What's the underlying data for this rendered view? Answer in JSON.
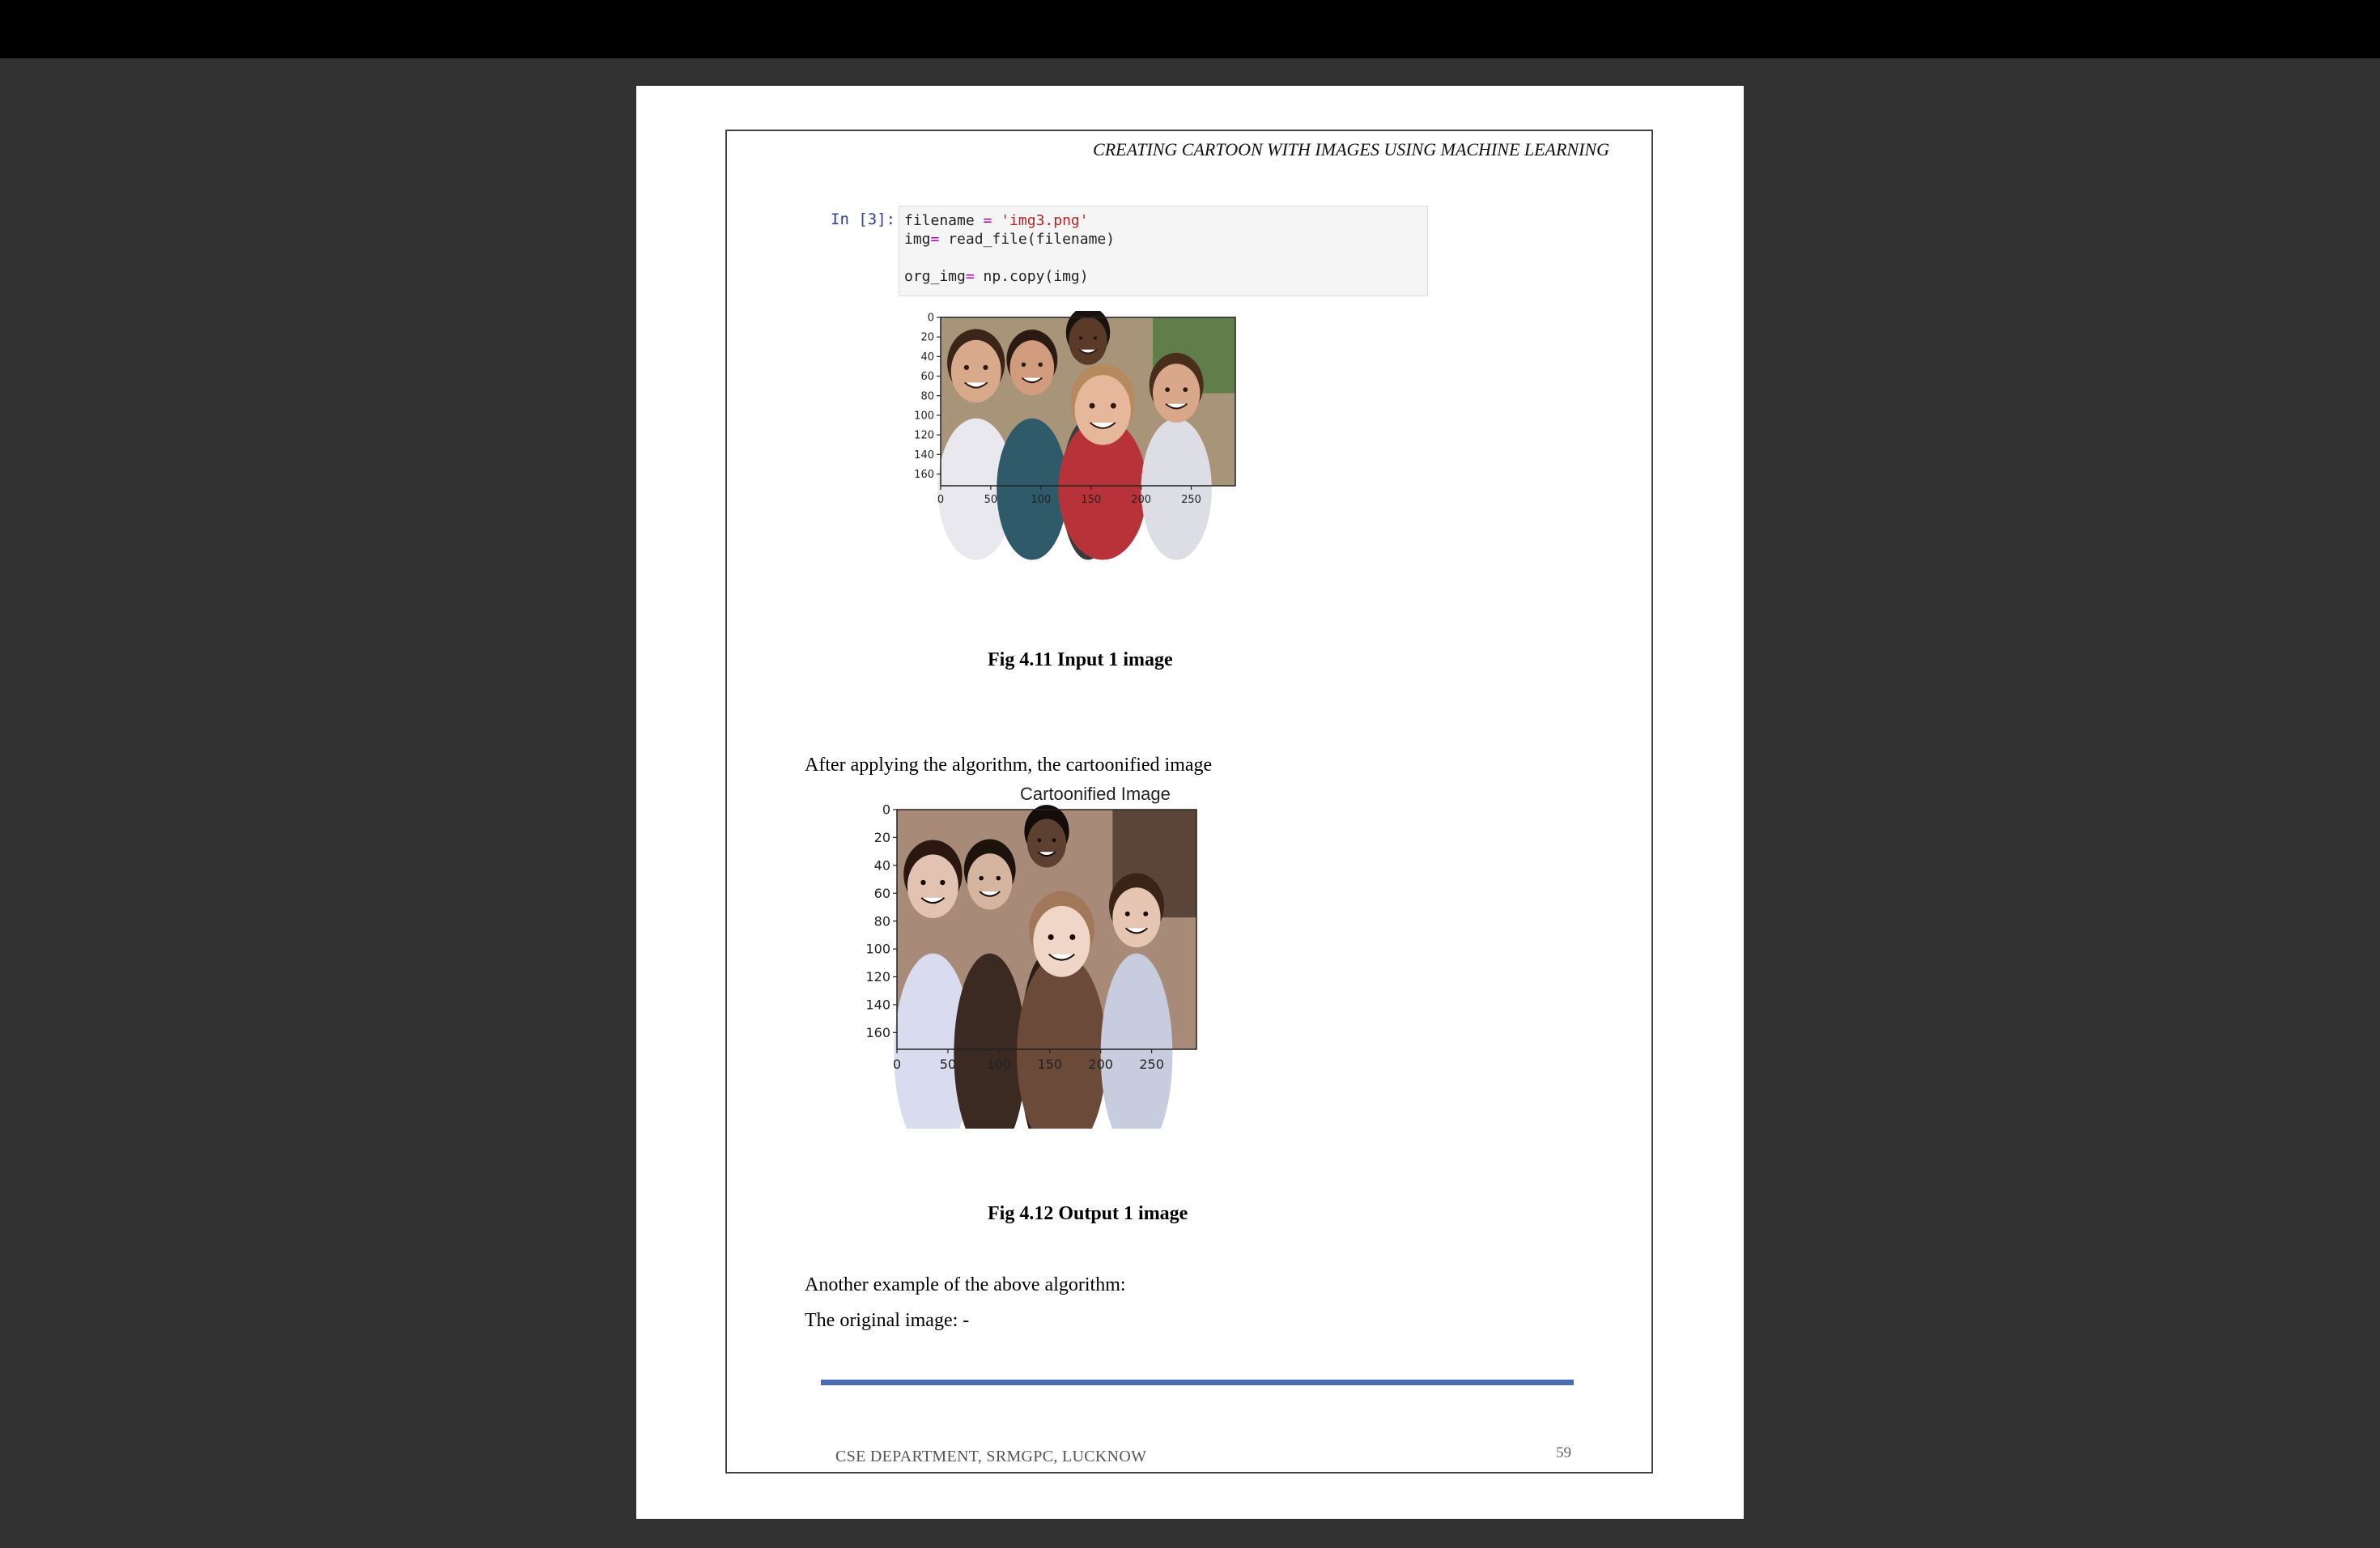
{
  "document": {
    "running_header": "CREATING CARTOON WITH IMAGES USING MACHINE LEARNING",
    "code_cell": {
      "prompt": "In [3]:",
      "lines": [
        {
          "var": "filename",
          "op": " = ",
          "rest": "'img3.png'",
          "kind": "str"
        },
        {
          "var": "img",
          "op": "= ",
          "rest": "read_file(filename)",
          "kind": "plain"
        },
        {
          "var": "",
          "op": "",
          "rest": "",
          "kind": "blank"
        },
        {
          "var": "org_img",
          "op": "= ",
          "rest": "np.copy(img)",
          "kind": "plain"
        }
      ]
    },
    "figure1": {
      "y_ticks": [
        "0",
        "20",
        "40",
        "60",
        "80",
        "100",
        "120",
        "140",
        "160"
      ],
      "x_ticks": [
        "0",
        "50",
        "100",
        "150",
        "200",
        "250"
      ],
      "caption": "Fig 4.11 Input 1 image"
    },
    "paragraph1": "After applying the algorithm, the cartoonified image",
    "figure2": {
      "title": "Cartoonified Image",
      "y_ticks": [
        "0",
        "20",
        "40",
        "60",
        "80",
        "100",
        "120",
        "140",
        "160"
      ],
      "x_ticks": [
        "0",
        "50",
        "100",
        "150",
        "200",
        "250"
      ],
      "caption": "Fig 4.12 Output 1 image"
    },
    "paragraph2": "Another example of the above algorithm:",
    "paragraph3": "The original image: -",
    "footer": {
      "department": "CSE DEPARTMENT, SRMGPC, LUCKNOW",
      "page_number": "59"
    }
  }
}
